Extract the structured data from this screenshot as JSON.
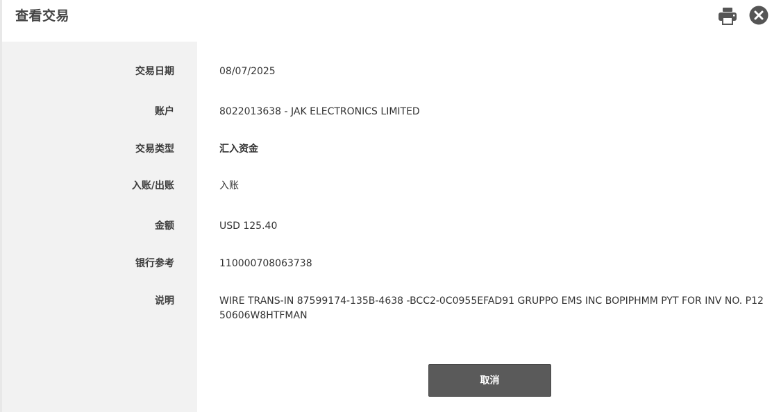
{
  "header": {
    "title": "查看交易",
    "print_icon": "printer-icon",
    "close_icon": "close-circle-icon"
  },
  "fields": [
    {
      "label": "交易日期",
      "value": "08/07/2025"
    },
    {
      "label": "账户",
      "value": "8022013638 - JAK ELECTRONICS LIMITED"
    },
    {
      "label": "交易类型",
      "value": "汇入资金"
    },
    {
      "label": "入账/出账",
      "value": "入账"
    },
    {
      "label": "金额",
      "value": "USD 125.40"
    },
    {
      "label": "银行参考",
      "value": "110000708063738"
    },
    {
      "label": "说明",
      "value": "WIRE TRANS-IN 87599174-135B-4638 -BCC2-0C0955EFAD91 GRUPPO EMS INC BOPIPHMM PYT FOR INV NO. P1250606W8HTFMAN"
    }
  ],
  "footer": {
    "cancel_label": "取消"
  },
  "colors": {
    "label_bg": "#f2f2f2",
    "button_bg": "#5a5a5a",
    "icon_color": "#555555"
  }
}
